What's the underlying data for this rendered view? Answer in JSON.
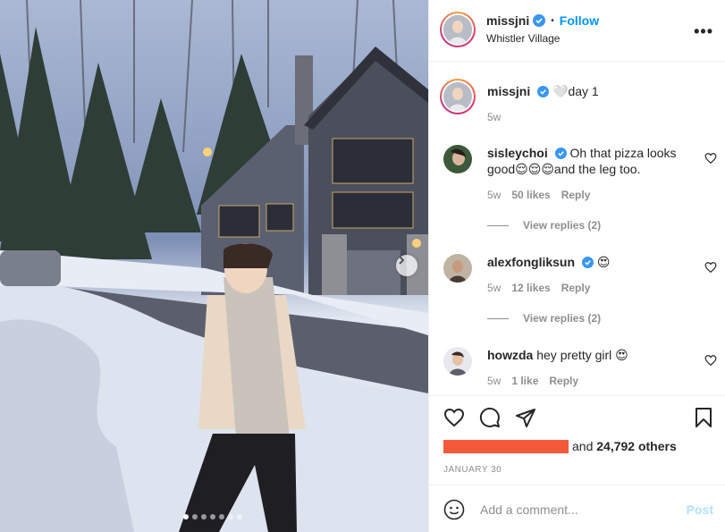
{
  "post": {
    "username": "missjni",
    "follow_label": "Follow",
    "separator": "•",
    "location": "Whistler Village",
    "more_label": "•••"
  },
  "caption": {
    "username": "missjni",
    "emoji": "🤍",
    "text": "day 1",
    "time": "5w"
  },
  "comments": [
    {
      "username": "sisleychoi",
      "verified": true,
      "text_line1": "Oh that pizza looks",
      "text_line2": "good😌😌😌and the leg too.",
      "time": "5w",
      "likes": "50 likes",
      "reply": "Reply",
      "view_replies": "View replies (2)"
    },
    {
      "username": "alexfongliksun",
      "verified": true,
      "text": "😍",
      "time": "5w",
      "likes": "12 likes",
      "reply": "Reply",
      "view_replies": "View replies (2)"
    },
    {
      "username": "howzda",
      "verified": false,
      "text": "hey pretty girl 😍",
      "time": "5w",
      "likes": "1 like",
      "reply": "Reply"
    }
  ],
  "actions": {
    "like_icon": "heart-icon",
    "comment_icon": "comment-bubble-icon",
    "share_icon": "paper-plane-icon",
    "save_icon": "bookmark-icon",
    "likes_suffix": "and",
    "likes_count": "24,792 others",
    "date": "JANUARY 30"
  },
  "comment_input": {
    "placeholder": "Add a comment...",
    "post_label": "Post"
  },
  "carousel": {
    "slide_count": 7,
    "active_index": 0
  },
  "colors": {
    "accent": "#0095f6",
    "verified": "#3897f0",
    "muted": "#8e8e8e",
    "post_disabled": "#b2dffc",
    "redaction": "#f25a3a"
  }
}
